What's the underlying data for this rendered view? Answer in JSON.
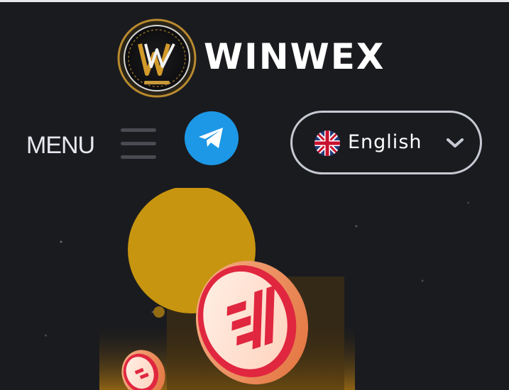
{
  "header": {
    "brand_name": "WINWEX",
    "logo_icon": "winwex-logo-emblem"
  },
  "nav": {
    "menu_label": "MENU",
    "menu_icon": "hamburger-icon",
    "telegram_icon": "telegram-icon"
  },
  "language": {
    "selected": "English",
    "flag_icon": "uk-flag-icon",
    "dropdown_icon": "chevron-down-icon"
  },
  "colors": {
    "background": "#1a1b1f",
    "telegram_blue": "#1d98e6",
    "gold": "#d59a0c",
    "coin_red": "#e0273f"
  },
  "hero": {
    "image": "crypto-coins-illustration"
  }
}
